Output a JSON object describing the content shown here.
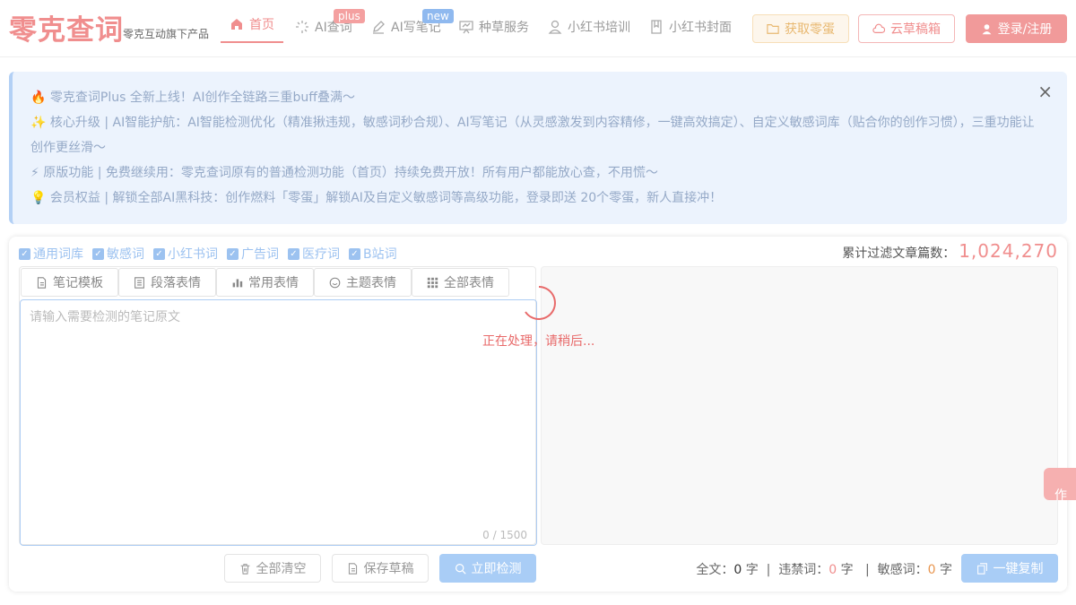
{
  "header": {
    "logo": "零克查词",
    "logo_sub": "零克互动旗下产品",
    "nav": [
      {
        "label": "首页",
        "icon": "home-icon"
      },
      {
        "label": "AI查词",
        "icon": "sparkle-icon",
        "badge": "plus"
      },
      {
        "label": "AI写笔记",
        "icon": "pen-icon",
        "badge": "new"
      },
      {
        "label": "种草服务",
        "icon": "presentation-icon"
      },
      {
        "label": "小红书培训",
        "icon": "user-icon"
      },
      {
        "label": "小红书封面",
        "icon": "book-icon"
      }
    ],
    "egg_btn": "获取零蛋",
    "cloud_btn": "云草稿箱",
    "login_btn": "登录/注册"
  },
  "notice": {
    "line1": "🔥 零克查词Plus 全新上线！AI创作全链路三重buff叠满～",
    "line2": "✨ 核心升级 | AI智能护航：AI智能检测优化（精准揪违规，敏感词秒合规）、AI写笔记（从灵感激发到内容精修，一键高效搞定）、自定义敏感词库（贴合你的创作习惯），三重功能让",
    "line3": "创作更丝滑～",
    "line4": "⚡ 原版功能 | 免费继续用：零克查词原有的普通检测功能（首页）持续免费开放！所有用户都能放心查，不用慌～",
    "line5": "💡 会员权益 | 解锁全部AI黑科技：创作燃料「零蛋」解锁AI及自定义敏感词等高级功能，登录即送 20个零蛋，新人直接冲！",
    "close": "×"
  },
  "filters": [
    "通用词库",
    "敏感词",
    "小红书词",
    "广告词",
    "医疗词",
    "B站词"
  ],
  "total_label": "累计过滤文章篇数：",
  "total_value": "1,024,270",
  "tabs": [
    {
      "label": "笔记模板",
      "icon": "document-icon"
    },
    {
      "label": "段落表情",
      "icon": "list-icon"
    },
    {
      "label": "常用表情",
      "icon": "bar-chart-icon"
    },
    {
      "label": "主题表情",
      "icon": "face-icon"
    },
    {
      "label": "全部表情",
      "icon": "grid-icon"
    }
  ],
  "editor": {
    "placeholder": "请输入需要检测的笔记原文",
    "counter": "0 / 1500"
  },
  "loading": "正在处理，请稍后...",
  "buttons": {
    "clear": "全部清空",
    "save": "保存草稿",
    "check": "立即检测",
    "copy": "一键复制"
  },
  "stats": {
    "full_label": "全文：",
    "full_val": "0",
    "unit": "字",
    "sep": "|",
    "ban_label": "违禁词：",
    "ban_val": "0",
    "sens_label": "敏感词：",
    "sens_val": "0"
  },
  "side_tab": "作"
}
